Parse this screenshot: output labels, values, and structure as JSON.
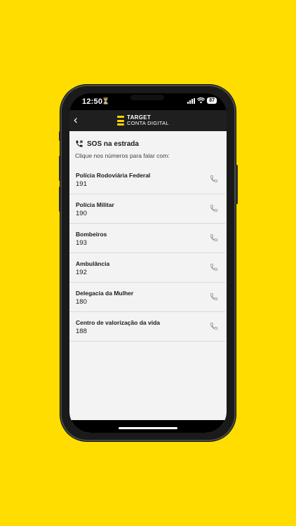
{
  "status_bar": {
    "time": "12:50",
    "battery": "87"
  },
  "app_bar": {
    "back_glyph": "‹",
    "logo_line1": "TARGET",
    "logo_line2": "CONTA DIGITAL",
    "brand_color": "#ffd400"
  },
  "page": {
    "title": "SOS na estrada",
    "subtitle": "Clique nos números para falar com:"
  },
  "contacts": [
    {
      "name": "Polícia Rodoviária Federal",
      "number": "191"
    },
    {
      "name": "Polícia Militar",
      "number": "190"
    },
    {
      "name": "Bombeiros",
      "number": "193"
    },
    {
      "name": "Ambulância",
      "number": "192"
    },
    {
      "name": "Delegacia da Mulher",
      "number": "180"
    },
    {
      "name": "Centro de valorização da vida",
      "number": "188"
    }
  ],
  "icons": {
    "title_icon": "phone-call-icon",
    "row_icon": "phone-icon"
  }
}
